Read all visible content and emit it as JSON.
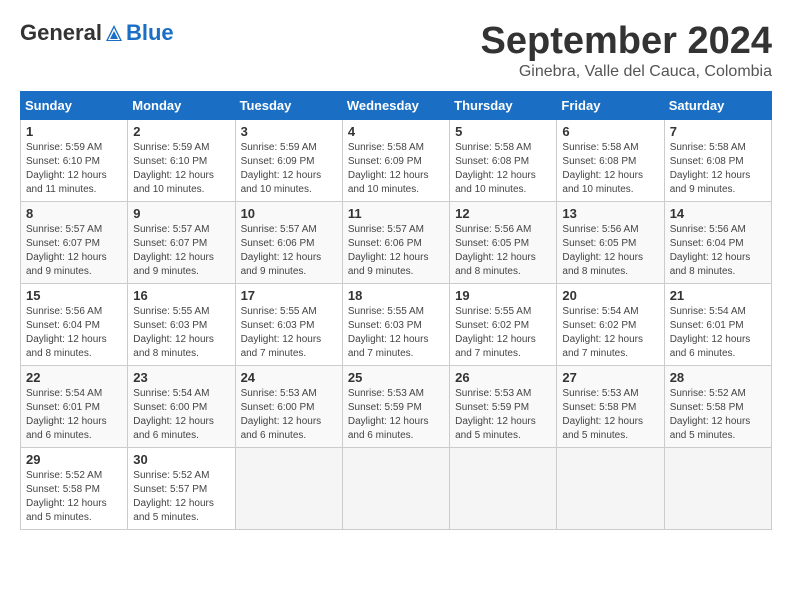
{
  "header": {
    "logo_general": "General",
    "logo_blue": "Blue",
    "month_title": "September 2024",
    "location": "Ginebra, Valle del Cauca, Colombia"
  },
  "weekdays": [
    "Sunday",
    "Monday",
    "Tuesday",
    "Wednesday",
    "Thursday",
    "Friday",
    "Saturday"
  ],
  "weeks": [
    [
      {
        "day": "1",
        "sunrise": "5:59 AM",
        "sunset": "6:10 PM",
        "daylight": "12 hours and 11 minutes."
      },
      {
        "day": "2",
        "sunrise": "5:59 AM",
        "sunset": "6:10 PM",
        "daylight": "12 hours and 10 minutes."
      },
      {
        "day": "3",
        "sunrise": "5:59 AM",
        "sunset": "6:09 PM",
        "daylight": "12 hours and 10 minutes."
      },
      {
        "day": "4",
        "sunrise": "5:58 AM",
        "sunset": "6:09 PM",
        "daylight": "12 hours and 10 minutes."
      },
      {
        "day": "5",
        "sunrise": "5:58 AM",
        "sunset": "6:08 PM",
        "daylight": "12 hours and 10 minutes."
      },
      {
        "day": "6",
        "sunrise": "5:58 AM",
        "sunset": "6:08 PM",
        "daylight": "12 hours and 10 minutes."
      },
      {
        "day": "7",
        "sunrise": "5:58 AM",
        "sunset": "6:08 PM",
        "daylight": "12 hours and 9 minutes."
      }
    ],
    [
      {
        "day": "8",
        "sunrise": "5:57 AM",
        "sunset": "6:07 PM",
        "daylight": "12 hours and 9 minutes."
      },
      {
        "day": "9",
        "sunrise": "5:57 AM",
        "sunset": "6:07 PM",
        "daylight": "12 hours and 9 minutes."
      },
      {
        "day": "10",
        "sunrise": "5:57 AM",
        "sunset": "6:06 PM",
        "daylight": "12 hours and 9 minutes."
      },
      {
        "day": "11",
        "sunrise": "5:57 AM",
        "sunset": "6:06 PM",
        "daylight": "12 hours and 9 minutes."
      },
      {
        "day": "12",
        "sunrise": "5:56 AM",
        "sunset": "6:05 PM",
        "daylight": "12 hours and 8 minutes."
      },
      {
        "day": "13",
        "sunrise": "5:56 AM",
        "sunset": "6:05 PM",
        "daylight": "12 hours and 8 minutes."
      },
      {
        "day": "14",
        "sunrise": "5:56 AM",
        "sunset": "6:04 PM",
        "daylight": "12 hours and 8 minutes."
      }
    ],
    [
      {
        "day": "15",
        "sunrise": "5:56 AM",
        "sunset": "6:04 PM",
        "daylight": "12 hours and 8 minutes."
      },
      {
        "day": "16",
        "sunrise": "5:55 AM",
        "sunset": "6:03 PM",
        "daylight": "12 hours and 8 minutes."
      },
      {
        "day": "17",
        "sunrise": "5:55 AM",
        "sunset": "6:03 PM",
        "daylight": "12 hours and 7 minutes."
      },
      {
        "day": "18",
        "sunrise": "5:55 AM",
        "sunset": "6:03 PM",
        "daylight": "12 hours and 7 minutes."
      },
      {
        "day": "19",
        "sunrise": "5:55 AM",
        "sunset": "6:02 PM",
        "daylight": "12 hours and 7 minutes."
      },
      {
        "day": "20",
        "sunrise": "5:54 AM",
        "sunset": "6:02 PM",
        "daylight": "12 hours and 7 minutes."
      },
      {
        "day": "21",
        "sunrise": "5:54 AM",
        "sunset": "6:01 PM",
        "daylight": "12 hours and 6 minutes."
      }
    ],
    [
      {
        "day": "22",
        "sunrise": "5:54 AM",
        "sunset": "6:01 PM",
        "daylight": "12 hours and 6 minutes."
      },
      {
        "day": "23",
        "sunrise": "5:54 AM",
        "sunset": "6:00 PM",
        "daylight": "12 hours and 6 minutes."
      },
      {
        "day": "24",
        "sunrise": "5:53 AM",
        "sunset": "6:00 PM",
        "daylight": "12 hours and 6 minutes."
      },
      {
        "day": "25",
        "sunrise": "5:53 AM",
        "sunset": "5:59 PM",
        "daylight": "12 hours and 6 minutes."
      },
      {
        "day": "26",
        "sunrise": "5:53 AM",
        "sunset": "5:59 PM",
        "daylight": "12 hours and 5 minutes."
      },
      {
        "day": "27",
        "sunrise": "5:53 AM",
        "sunset": "5:58 PM",
        "daylight": "12 hours and 5 minutes."
      },
      {
        "day": "28",
        "sunrise": "5:52 AM",
        "sunset": "5:58 PM",
        "daylight": "12 hours and 5 minutes."
      }
    ],
    [
      {
        "day": "29",
        "sunrise": "5:52 AM",
        "sunset": "5:58 PM",
        "daylight": "12 hours and 5 minutes."
      },
      {
        "day": "30",
        "sunrise": "5:52 AM",
        "sunset": "5:57 PM",
        "daylight": "12 hours and 5 minutes."
      },
      null,
      null,
      null,
      null,
      null
    ]
  ],
  "labels": {
    "sunrise": "Sunrise:",
    "sunset": "Sunset:",
    "daylight": "Daylight:"
  }
}
